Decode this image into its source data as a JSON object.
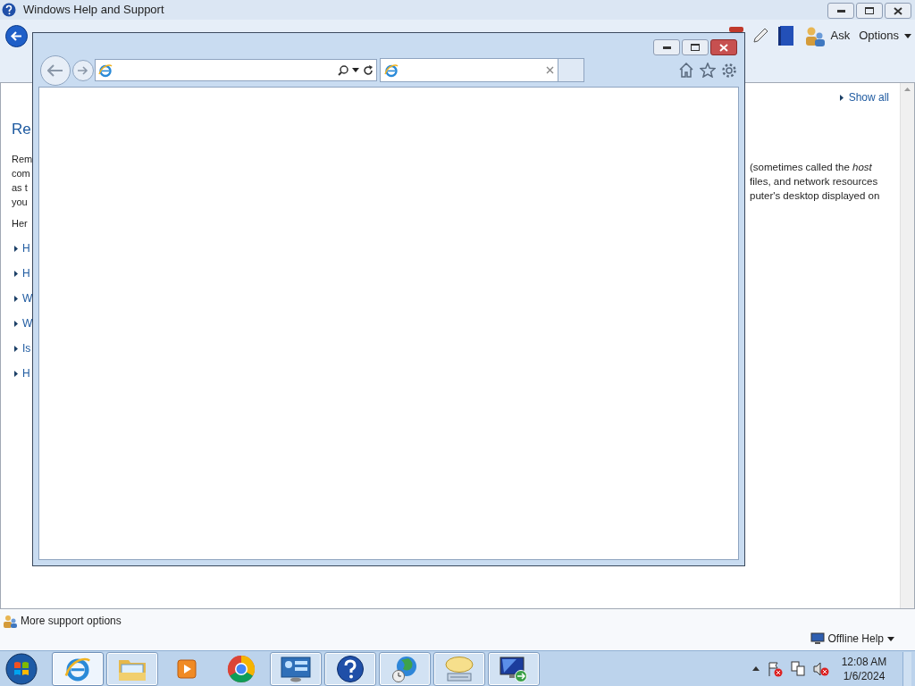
{
  "help_window": {
    "title": "Windows Help and Support",
    "toolbar": {
      "ask_label": "Ask",
      "options_label": "Options"
    },
    "show_all": "Show all",
    "heading": "Re",
    "paragraph_left": [
      "Rem",
      "com",
      "as t",
      "you"
    ],
    "paragraph_right": [
      "(sometimes called the *host*",
      "files, and network resources",
      "puter's desktop displayed on"
    ],
    "intro": "Her",
    "links": [
      "H",
      "H",
      "W",
      "W",
      "Is",
      "H"
    ],
    "more_support": "More support options",
    "offline_help": "Offline Help"
  },
  "taskbar": {
    "apps": [
      {
        "kind": "ie",
        "running": true,
        "selected": true
      },
      {
        "kind": "explorer",
        "running": true,
        "selected": false
      },
      {
        "kind": "media",
        "running": false,
        "selected": false
      },
      {
        "kind": "chrome",
        "running": false,
        "selected": false
      },
      {
        "kind": "control",
        "running": true,
        "selected": false
      },
      {
        "kind": "help",
        "running": true,
        "selected": false
      },
      {
        "kind": "globe",
        "running": true,
        "selected": false
      },
      {
        "kind": "keyboard",
        "running": true,
        "selected": false
      },
      {
        "kind": "remote",
        "running": true,
        "selected": false
      }
    ],
    "clock": {
      "time": "12:08 AM",
      "date": "1/6/2024"
    }
  }
}
